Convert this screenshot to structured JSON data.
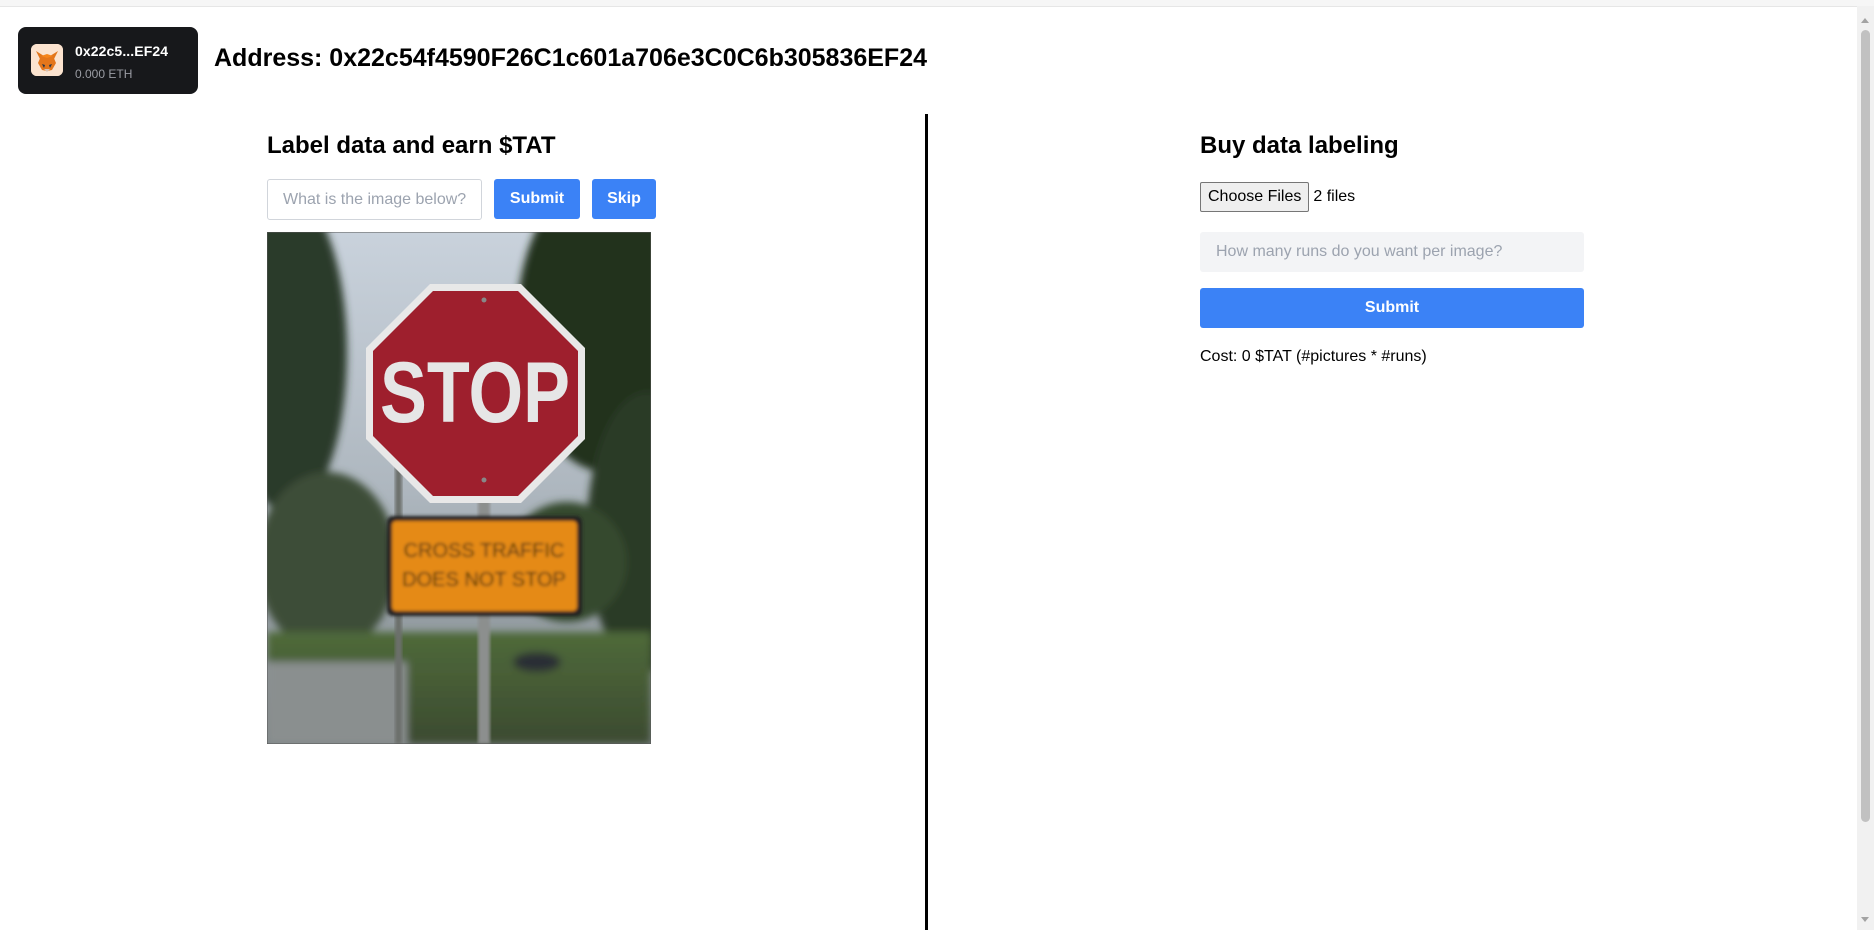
{
  "wallet": {
    "name": "0x22c5...EF24",
    "balance": "0.000 ETH",
    "icon": "metamask-fox-icon"
  },
  "header": {
    "address_text": "Address: 0x22c54f4590F26C1c601a706e3C0C6b305836EF24"
  },
  "label_panel": {
    "title": "Label data and earn $TAT",
    "input_placeholder": "What is the image below?",
    "submit_label": "Submit",
    "skip_label": "Skip",
    "image": {
      "sign_text": "STOP",
      "plate_line_1": "CROSS TRAFFIC",
      "plate_line_2": "DOES NOT STOP"
    }
  },
  "buy_panel": {
    "title": "Buy data labeling",
    "choose_files_label": "Choose Files",
    "files_selected": "2 files",
    "runs_placeholder": "How many runs do you want per image?",
    "submit_label": "Submit",
    "cost_text": "Cost: 0 $TAT (#pictures * #runs)"
  },
  "colors": {
    "accent": "#3b82f6",
    "wallet_bg": "#17181b",
    "divider": "#000000"
  }
}
